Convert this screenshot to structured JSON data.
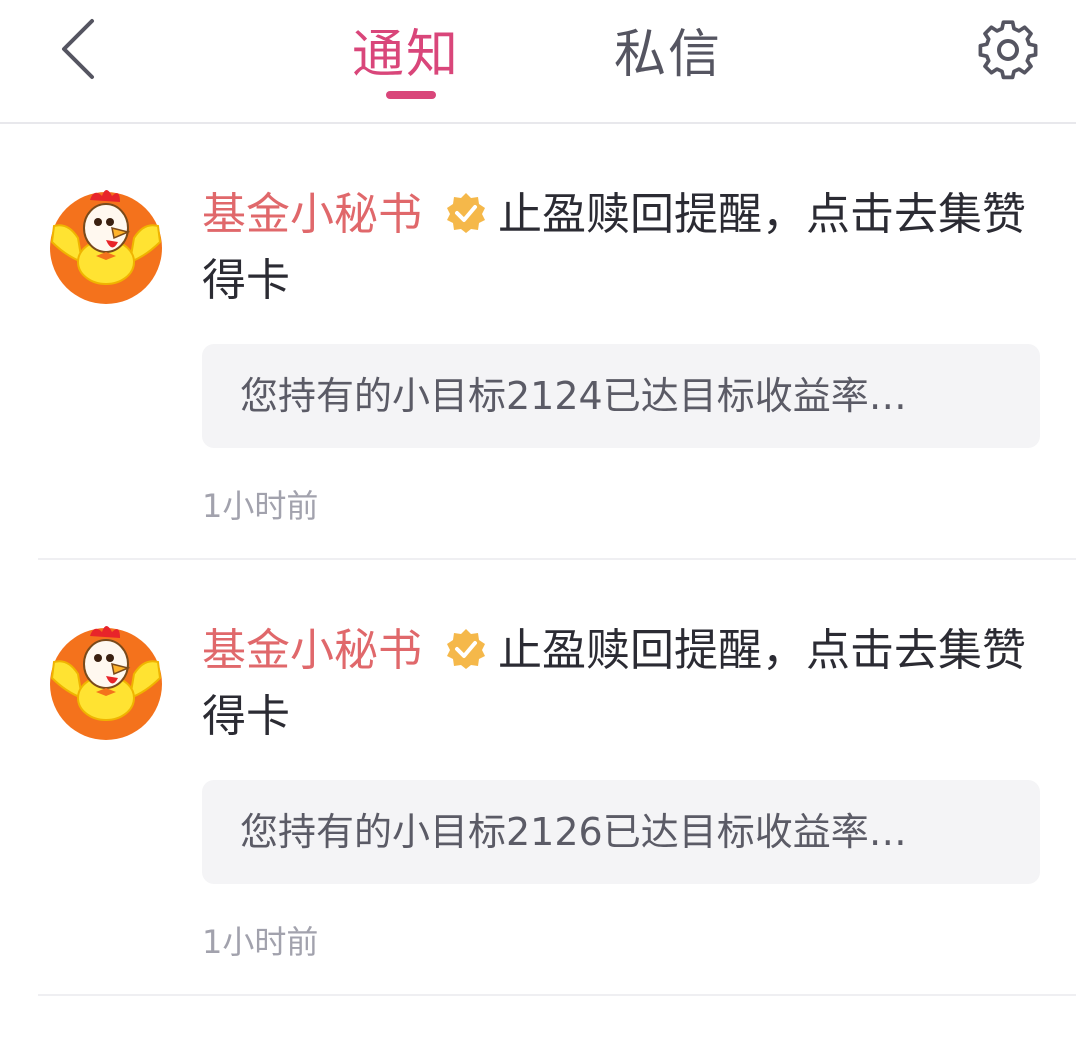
{
  "header": {
    "tabs": [
      {
        "label": "通知",
        "active": true
      },
      {
        "label": "私信",
        "active": false
      }
    ],
    "accent_color": "#d9467a"
  },
  "notifications": [
    {
      "sender": "基金小秘书",
      "message": "止盈赎回提醒，点击去集赞得卡",
      "quote": "您持有的小目标2124已达目标收益率…",
      "time": "1小时前"
    },
    {
      "sender": "基金小秘书",
      "message": "止盈赎回提醒，点击去集赞得卡",
      "quote": "您持有的小目标2126已达目标收益率…",
      "time": "1小时前"
    }
  ],
  "icons": {
    "back": "chevron-left-icon",
    "settings": "gear-icon",
    "verified": "verified-badge-icon",
    "avatar": "rooster-mascot-avatar"
  },
  "colors": {
    "sender": "#e0686b",
    "verified_badge": "#f5b84a",
    "quote_bg": "#f4f4f6"
  }
}
